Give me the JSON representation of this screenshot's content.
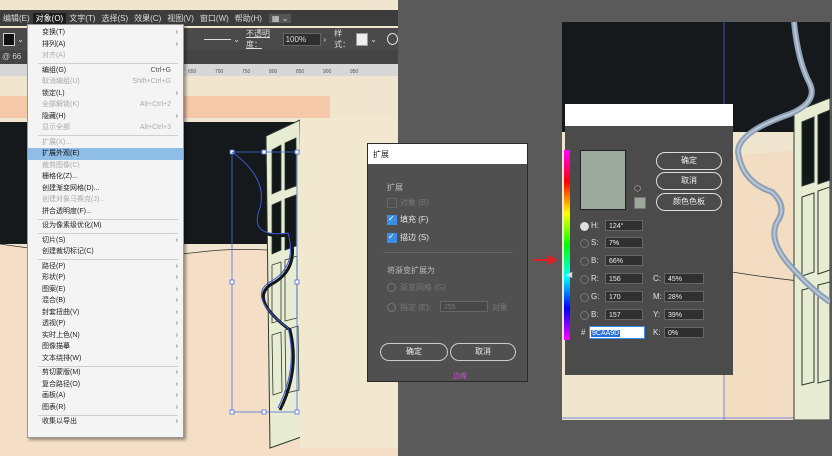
{
  "menubar": {
    "items": [
      "编辑(E)",
      "对象(O)",
      "文字(T)",
      "选择(S)",
      "效果(C)",
      "视图(V)",
      "窗口(W)",
      "帮助(H)"
    ]
  },
  "control_bar": {
    "opacity_label": "不透明度：",
    "opacity_value": "100%",
    "style_label": "样式："
  },
  "doc_tab": "@ 66",
  "ruler_ticks": [
    "650",
    "700",
    "750",
    "800",
    "850",
    "900",
    "950"
  ],
  "object_menu": {
    "items": [
      {
        "label": "变换(T)",
        "shortcut": "",
        "submenu": true,
        "disabled": false
      },
      {
        "label": "排列(A)",
        "shortcut": "",
        "submenu": true,
        "disabled": false
      },
      {
        "label": "对齐(A)",
        "shortcut": "",
        "submenu": false,
        "disabled": true
      },
      {
        "sep": true
      },
      {
        "label": "编组(G)",
        "shortcut": "Ctrl+G",
        "submenu": false,
        "disabled": false
      },
      {
        "label": "取消编组(U)",
        "shortcut": "Shift+Ctrl+G",
        "submenu": false,
        "disabled": true
      },
      {
        "label": "锁定(L)",
        "shortcut": "",
        "submenu": true,
        "disabled": false
      },
      {
        "label": "全部解锁(K)",
        "shortcut": "Alt+Ctrl+2",
        "submenu": false,
        "disabled": true
      },
      {
        "label": "隐藏(H)",
        "shortcut": "",
        "submenu": true,
        "disabled": false
      },
      {
        "label": "显示全部",
        "shortcut": "Alt+Ctrl+3",
        "submenu": false,
        "disabled": true
      },
      {
        "sep": true
      },
      {
        "label": "扩展(X)...",
        "shortcut": "",
        "submenu": false,
        "disabled": true
      },
      {
        "label": "扩展外观(E)",
        "shortcut": "",
        "submenu": false,
        "disabled": false,
        "highlight": true
      },
      {
        "label": "裁剪图像(C)",
        "shortcut": "",
        "submenu": false,
        "disabled": true
      },
      {
        "label": "栅格化(Z)...",
        "shortcut": "",
        "submenu": false,
        "disabled": false
      },
      {
        "label": "创建渐变网格(D)...",
        "shortcut": "",
        "submenu": false,
        "disabled": false
      },
      {
        "label": "创建对象马赛克(J)...",
        "shortcut": "",
        "submenu": false,
        "disabled": true
      },
      {
        "label": "拼合透明度(F)...",
        "shortcut": "",
        "submenu": false,
        "disabled": false
      },
      {
        "sep": true
      },
      {
        "label": "设为像素级优化(M)",
        "shortcut": "",
        "submenu": false,
        "disabled": false
      },
      {
        "sep": true
      },
      {
        "label": "切片(S)",
        "shortcut": "",
        "submenu": true,
        "disabled": false
      },
      {
        "label": "创建裁切标记(C)",
        "shortcut": "",
        "submenu": false,
        "disabled": false
      },
      {
        "sep": true
      },
      {
        "label": "路径(P)",
        "shortcut": "",
        "submenu": true,
        "disabled": false
      },
      {
        "label": "形状(P)",
        "shortcut": "",
        "submenu": true,
        "disabled": false
      },
      {
        "label": "图案(E)",
        "shortcut": "",
        "submenu": true,
        "disabled": false
      },
      {
        "label": "混合(B)",
        "shortcut": "",
        "submenu": true,
        "disabled": false
      },
      {
        "label": "封套扭曲(V)",
        "shortcut": "",
        "submenu": true,
        "disabled": false
      },
      {
        "label": "透视(P)",
        "shortcut": "",
        "submenu": true,
        "disabled": false
      },
      {
        "label": "实时上色(N)",
        "shortcut": "",
        "submenu": true,
        "disabled": false
      },
      {
        "label": "图像描摹",
        "shortcut": "",
        "submenu": true,
        "disabled": false
      },
      {
        "label": "文本绕排(W)",
        "shortcut": "",
        "submenu": true,
        "disabled": false
      },
      {
        "sep": true
      },
      {
        "label": "剪切蒙版(M)",
        "shortcut": "",
        "submenu": true,
        "disabled": false
      },
      {
        "label": "复合路径(O)",
        "shortcut": "",
        "submenu": true,
        "disabled": false
      },
      {
        "label": "画板(A)",
        "shortcut": "",
        "submenu": true,
        "disabled": false
      },
      {
        "label": "图表(R)",
        "shortcut": "",
        "submenu": true,
        "disabled": false
      },
      {
        "sep": true
      },
      {
        "label": "收集以导出",
        "shortcut": "",
        "submenu": true,
        "disabled": false
      }
    ]
  },
  "expand_dialog": {
    "title": "扩展",
    "section_expand": "扩展",
    "object_label": "对象 (B)",
    "fill_label": "填充 (F)",
    "fill_checked": true,
    "stroke_label": "描边 (S)",
    "stroke_checked": true,
    "section_gradient": "将渐变扩展为",
    "gradient_mesh_label": "渐变网格 (G)",
    "specify_label": "指定 (E):",
    "specify_value": "255",
    "specify_unit": "对象",
    "ok_label": "确定",
    "cancel_label": "取消",
    "footer_label": "边缘"
  },
  "color_picker": {
    "ok_label": "确定",
    "cancel_label": "取消",
    "swatches_label": "颜色色板",
    "H_label": "H:",
    "H": "124°",
    "S_label": "S:",
    "S": "7%",
    "B_label": "B:",
    "B": "66%",
    "R_label": "R:",
    "R": "156",
    "G_label": "G:",
    "G": "170",
    "Bl_label": "B:",
    "Bl": "157",
    "C_label": "C:",
    "C": "45%",
    "M_label": "M:",
    "M": "28%",
    "Y_label": "Y:",
    "Y": "39%",
    "K_label": "K:",
    "K": "0%",
    "hex_label": "#",
    "hex": "9CAA9D",
    "current_color": "#9CAA9D"
  }
}
